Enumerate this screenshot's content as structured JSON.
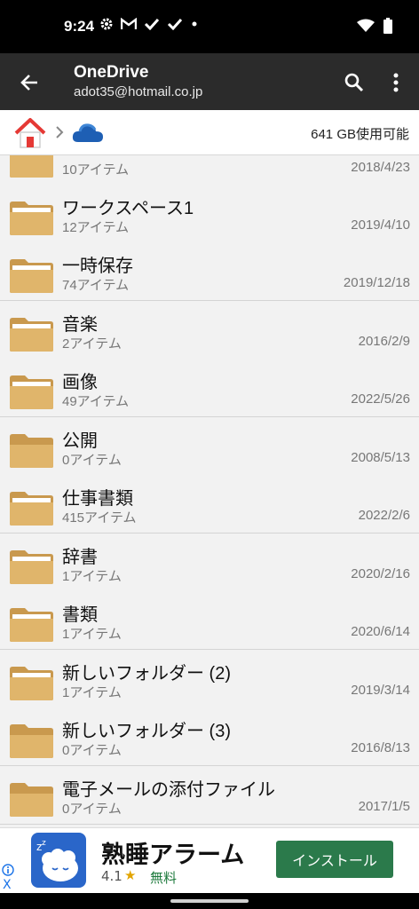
{
  "status_bar": {
    "time": "9:24",
    "icons": [
      "gear-icon",
      "gmail-icon",
      "check-icon",
      "check-icon",
      "dot-icon",
      "wifi-icon",
      "battery-icon"
    ]
  },
  "app_bar": {
    "title": "OneDrive",
    "subtitle": "adot35@hotmail.co.jp",
    "icons": [
      "back-arrow-icon",
      "search-icon",
      "more-vert-icon"
    ]
  },
  "breadcrumb": {
    "icons": [
      "home-icon",
      "chevron-right-icon",
      "onedrive-cloud-icon"
    ],
    "available": "641 GB使用可能"
  },
  "files": [
    {
      "name": "",
      "count": "10アイテム",
      "date": "2018/4/23"
    },
    {
      "name": "ワークスペース1",
      "count": "12アイテム",
      "date": "2019/4/10"
    },
    {
      "name": "一時保存",
      "count": "74アイテム",
      "date": "2019/12/18"
    },
    {
      "name": "音楽",
      "count": "2アイテム",
      "date": "2016/2/9"
    },
    {
      "name": "画像",
      "count": "49アイテム",
      "date": "2022/5/26"
    },
    {
      "name": "公開",
      "count": "0アイテム",
      "date": "2008/5/13"
    },
    {
      "name": "仕事書類",
      "count": "415アイテム",
      "date": "2022/2/6"
    },
    {
      "name": "辞書",
      "count": "1アイテム",
      "date": "2020/2/16"
    },
    {
      "name": "書類",
      "count": "1アイテム",
      "date": "2020/6/14"
    },
    {
      "name": "新しいフォルダー (2)",
      "count": "1アイテム",
      "date": "2019/3/14"
    },
    {
      "name": "新しいフォルダー (3)",
      "count": "0アイテム",
      "date": "2016/8/13"
    },
    {
      "name": "電子メールの添付ファイル",
      "count": "0アイテム",
      "date": "2017/1/5"
    }
  ],
  "ad": {
    "title": "熟睡アラーム",
    "rating": "4.1",
    "star": "★",
    "free_label": "無料",
    "install_label": "インストール",
    "close": "X"
  },
  "colors": {
    "folder": "#e0b56b",
    "folder_dark": "#c9994e",
    "app_bar": "#2b2b2b",
    "install": "#2b7a4b"
  }
}
